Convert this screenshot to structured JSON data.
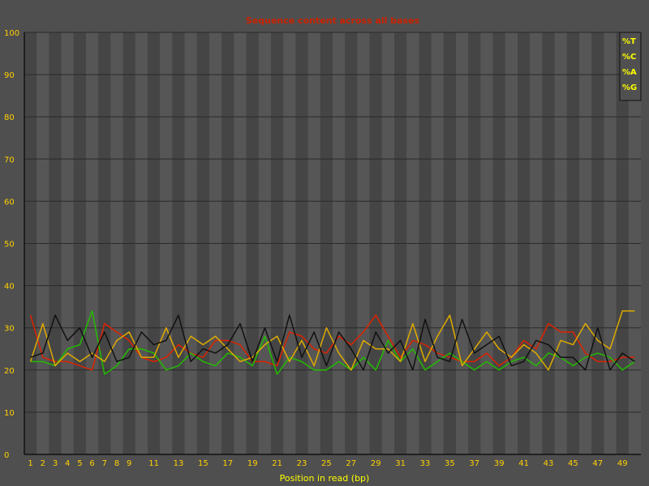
{
  "chart_data": {
    "type": "line",
    "title": "Sequence content across all bases",
    "xlabel": "Position in read (bp)",
    "ylabel": "",
    "ylim": [
      0,
      100
    ],
    "y_ticks": [
      0,
      10,
      20,
      30,
      40,
      50,
      60,
      70,
      80,
      90,
      100
    ],
    "x_categories": [
      "1",
      "2",
      "3",
      "4",
      "5",
      "6",
      "7",
      "8",
      "9",
      "10",
      "11",
      "12",
      "13",
      "14",
      "15",
      "16",
      "17",
      "18",
      "19",
      "20",
      "21",
      "22",
      "23",
      "24",
      "25",
      "26",
      "27",
      "28",
      "29",
      "30",
      "31",
      "32",
      "33",
      "34",
      "35",
      "36",
      "37",
      "38",
      "39",
      "40",
      "41",
      "42",
      "43",
      "44",
      "45",
      "46",
      "47",
      "48",
      "49",
      "50"
    ],
    "x_tick_labels": [
      "1",
      "2",
      "3",
      "4",
      "5",
      "6",
      "7",
      "8",
      "9",
      "11",
      "13",
      "15",
      "17",
      "19",
      "21",
      "23",
      "25",
      "27",
      "29",
      "31",
      "33",
      "35",
      "37",
      "39",
      "41",
      "43",
      "45",
      "47",
      "49"
    ],
    "x_tick_positions": [
      1,
      2,
      3,
      4,
      5,
      6,
      7,
      8,
      9,
      11,
      13,
      15,
      17,
      19,
      21,
      23,
      25,
      27,
      29,
      31,
      33,
      35,
      37,
      39,
      41,
      43,
      45,
      47,
      49
    ],
    "legend_position": "top-right",
    "grid": true,
    "series": [
      {
        "name": "%T",
        "color": "#dd2200",
        "values": [
          33,
          23,
          22,
          22,
          21,
          20,
          31,
          29,
          27,
          23,
          22,
          23,
          26,
          24,
          23,
          27,
          27,
          26,
          22,
          22,
          21,
          29,
          28,
          25,
          24,
          28,
          26,
          29,
          33,
          28,
          23,
          27,
          26,
          24,
          23,
          22,
          22,
          24,
          21,
          23,
          27,
          25,
          31,
          29,
          29,
          24,
          22,
          22,
          23,
          23
        ]
      },
      {
        "name": "%C",
        "color": "#22bb00",
        "values": [
          22,
          22,
          21,
          25,
          26,
          34,
          19,
          21,
          25,
          25,
          24,
          20,
          21,
          24,
          22,
          21,
          24,
          23,
          21,
          28,
          19,
          23,
          22,
          20,
          20,
          22,
          20,
          23,
          20,
          27,
          22,
          25,
          20,
          22,
          24,
          22,
          20,
          22,
          20,
          22,
          23,
          21,
          24,
          23,
          21,
          23,
          24,
          23,
          20,
          22
        ]
      },
      {
        "name": "%A",
        "color": "#ddaa00",
        "values": [
          22,
          31,
          21,
          24,
          22,
          24,
          22,
          27,
          29,
          23,
          23,
          30,
          23,
          28,
          26,
          28,
          25,
          22,
          23,
          26,
          28,
          22,
          27,
          21,
          30,
          24,
          20,
          27,
          25,
          25,
          22,
          31,
          22,
          28,
          33,
          21,
          25,
          29,
          25,
          23,
          26,
          24,
          20,
          27,
          26,
          31,
          27,
          25,
          34,
          34
        ]
      },
      {
        "name": "%G",
        "color": "#111111",
        "values": [
          23,
          24,
          33,
          27,
          30,
          23,
          29,
          22,
          23,
          29,
          26,
          27,
          33,
          22,
          25,
          24,
          26,
          31,
          22,
          30,
          22,
          33,
          23,
          29,
          21,
          29,
          25,
          20,
          29,
          24,
          27,
          20,
          32,
          23,
          22,
          32,
          24,
          26,
          28,
          21,
          22,
          27,
          26,
          23,
          23,
          20,
          30,
          20,
          24,
          22
        ]
      }
    ]
  }
}
